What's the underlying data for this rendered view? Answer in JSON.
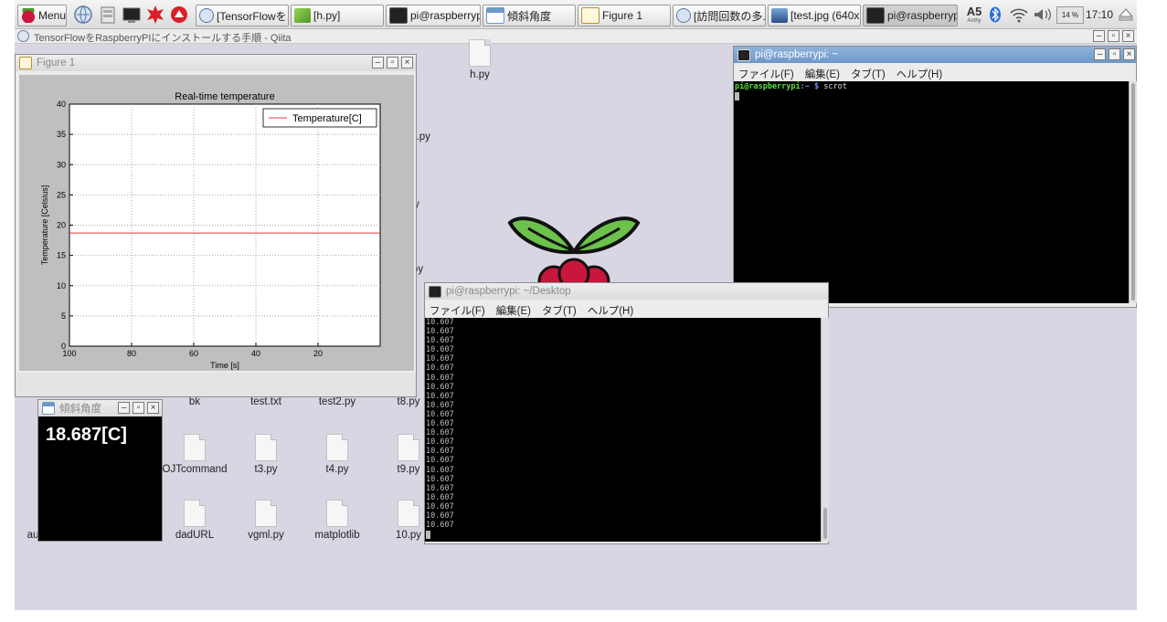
{
  "taskbar": {
    "menu_label": "Menu",
    "tasks": [
      {
        "label": "[TensorFlowを..."
      },
      {
        "label": "[h.py]"
      },
      {
        "label": "pi@raspberrypi..."
      },
      {
        "label": "傾斜角度"
      },
      {
        "label": "Figure 1"
      },
      {
        "label": "[訪問回数の多..."
      },
      {
        "label": "[test.jpg (640x..."
      },
      {
        "label": "pi@raspberrypi..."
      }
    ],
    "font_badge": "A5",
    "font_badge_sub": "Anthy",
    "cpu_label": "14 %",
    "clock": "17:10"
  },
  "browser": {
    "title": "TensorFlowをRaspberryPIにインストールする手順 - Qiita"
  },
  "desktop_icons": [
    {
      "label": "h.py"
    },
    {
      "label": "1.py"
    },
    {
      "label": "y"
    },
    {
      "label": "py"
    },
    {
      "label": "bk"
    },
    {
      "label": "test.txt"
    },
    {
      "label": "test2.py"
    },
    {
      "label": "t8.py"
    },
    {
      "label": "OJTcommand"
    },
    {
      "label": "t3.py"
    },
    {
      "label": "t4.py"
    },
    {
      "label": "t9.py"
    },
    {
      "label": "au"
    },
    {
      "label": "dadURL"
    },
    {
      "label": "vgml.py"
    },
    {
      "label": "matplotlib"
    },
    {
      "label": "10.py"
    }
  ],
  "figure_window": {
    "title": "Figure 1"
  },
  "chart_data": {
    "type": "line",
    "title": "Real-time temperature",
    "xlabel": "Time [s]",
    "ylabel": "Temperature [Celsius]",
    "xlim": [
      100,
      0
    ],
    "ylim": [
      0,
      40
    ],
    "xticks": [
      100,
      80,
      60,
      40,
      20
    ],
    "yticks": [
      0,
      5,
      10,
      15,
      20,
      25,
      30,
      35,
      40
    ],
    "grid": true,
    "legend_position": "top-right",
    "series": [
      {
        "name": "Temperature[C]",
        "color": "#e0383e",
        "x": [
          100,
          90,
          80,
          70,
          60,
          50,
          40,
          30,
          20,
          10,
          0
        ],
        "y": [
          18.7,
          18.7,
          18.7,
          18.7,
          18.7,
          18.7,
          18.7,
          18.7,
          18.7,
          18.7,
          18.7
        ]
      }
    ]
  },
  "tilt_window": {
    "title": "傾斜角度",
    "value": "18.687[C]"
  },
  "terminal_home": {
    "title": "pi@raspberrypi: ~",
    "menu": [
      "ファイル(F)",
      "編集(E)",
      "タブ(T)",
      "ヘルプ(H)"
    ],
    "prompt_user": "pi@raspberrypi",
    "prompt_path": ":~ $",
    "command": "scrot"
  },
  "terminal_desktop": {
    "title": "pi@raspberrypi: ~/Desktop",
    "menu": [
      "ファイル(F)",
      "編集(E)",
      "タブ(T)",
      "ヘルプ(H)"
    ],
    "lines": [
      "10.607",
      "10.607",
      "10.607",
      "10.607",
      "10.607",
      "10.607",
      "10.607",
      "10.607",
      "10.607",
      "10.607",
      "10.607",
      "10.607",
      "10.607",
      "10.607",
      "10.607",
      "10.607",
      "10.607",
      "10.607",
      "10.607",
      "10.607",
      "10.607",
      "10.607",
      "10.607"
    ]
  },
  "colors": {
    "desktop": "#d7d6e2",
    "accent": "#6e98c8",
    "prompt_green": "#55e43a",
    "prompt_blue": "#6c8cff"
  }
}
